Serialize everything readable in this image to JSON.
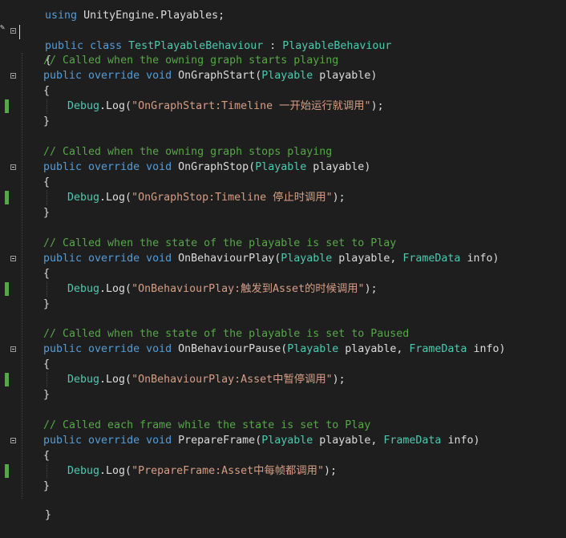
{
  "editor": {
    "lines": {
      "using": {
        "kw": "using",
        "rest": " UnityEngine.Playables;"
      },
      "class_decl": {
        "kw": "public class",
        "name": "TestPlayableBehaviour",
        "sep": " : ",
        "base": "PlayableBehaviour"
      },
      "open_brace": "{",
      "close_brace": "}",
      "methods": [
        {
          "comment": "// Called when the owning graph starts playing",
          "modifiers": "public override void",
          "name": "OnGraphStart",
          "param_type": "Playable",
          "param_name": "playable",
          "extra_type": "",
          "extra_name": "",
          "log_prefix": "Debug.Log(",
          "log_string": "\"OnGraphStart:Timeline 一开始运行就调用\"",
          "log_suffix": ");"
        },
        {
          "comment": "// Called when the owning graph stops playing",
          "modifiers": "public override void",
          "name": "OnGraphStop",
          "param_type": "Playable",
          "param_name": "playable",
          "extra_type": "",
          "extra_name": "",
          "log_prefix": "Debug.Log(",
          "log_string": "\"OnGraphStop:Timeline 停止时调用\"",
          "log_suffix": ");"
        },
        {
          "comment": "// Called when the state of the playable is set to Play",
          "modifiers": "public override void",
          "name": "OnBehaviourPlay",
          "param_type": "Playable",
          "param_name": "playable,",
          "extra_type": "FrameData",
          "extra_name": "info",
          "log_prefix": "Debug.Log(",
          "log_string": "\"OnBehaviourPlay:触发到Asset的时候调用\"",
          "log_suffix": ");"
        },
        {
          "comment": "// Called when the state of the playable is set to Paused",
          "modifiers": "public override void",
          "name": "OnBehaviourPause",
          "param_type": "Playable",
          "param_name": "playable,",
          "extra_type": "FrameData",
          "extra_name": "info",
          "log_prefix": "Debug.Log(",
          "log_string": "\"OnBehaviourPlay:Asset中暂停调用\"",
          "log_suffix": ");"
        },
        {
          "comment": "// Called each frame while the state is set to Play",
          "modifiers": "public override void",
          "name": "PrepareFrame",
          "param_type": "Playable",
          "param_name": "playable,",
          "extra_type": "FrameData",
          "extra_name": "info",
          "log_prefix": "Debug.Log(",
          "log_string": "\"PrepareFrame:Asset中每帧都调用\"",
          "log_suffix": ");"
        }
      ]
    },
    "colors": {
      "background": "#1e1e1e",
      "keyword": "#569cd6",
      "type": "#4ec9b0",
      "comment": "#57a64a",
      "string": "#d69d85",
      "text": "#dcdcdc"
    }
  }
}
